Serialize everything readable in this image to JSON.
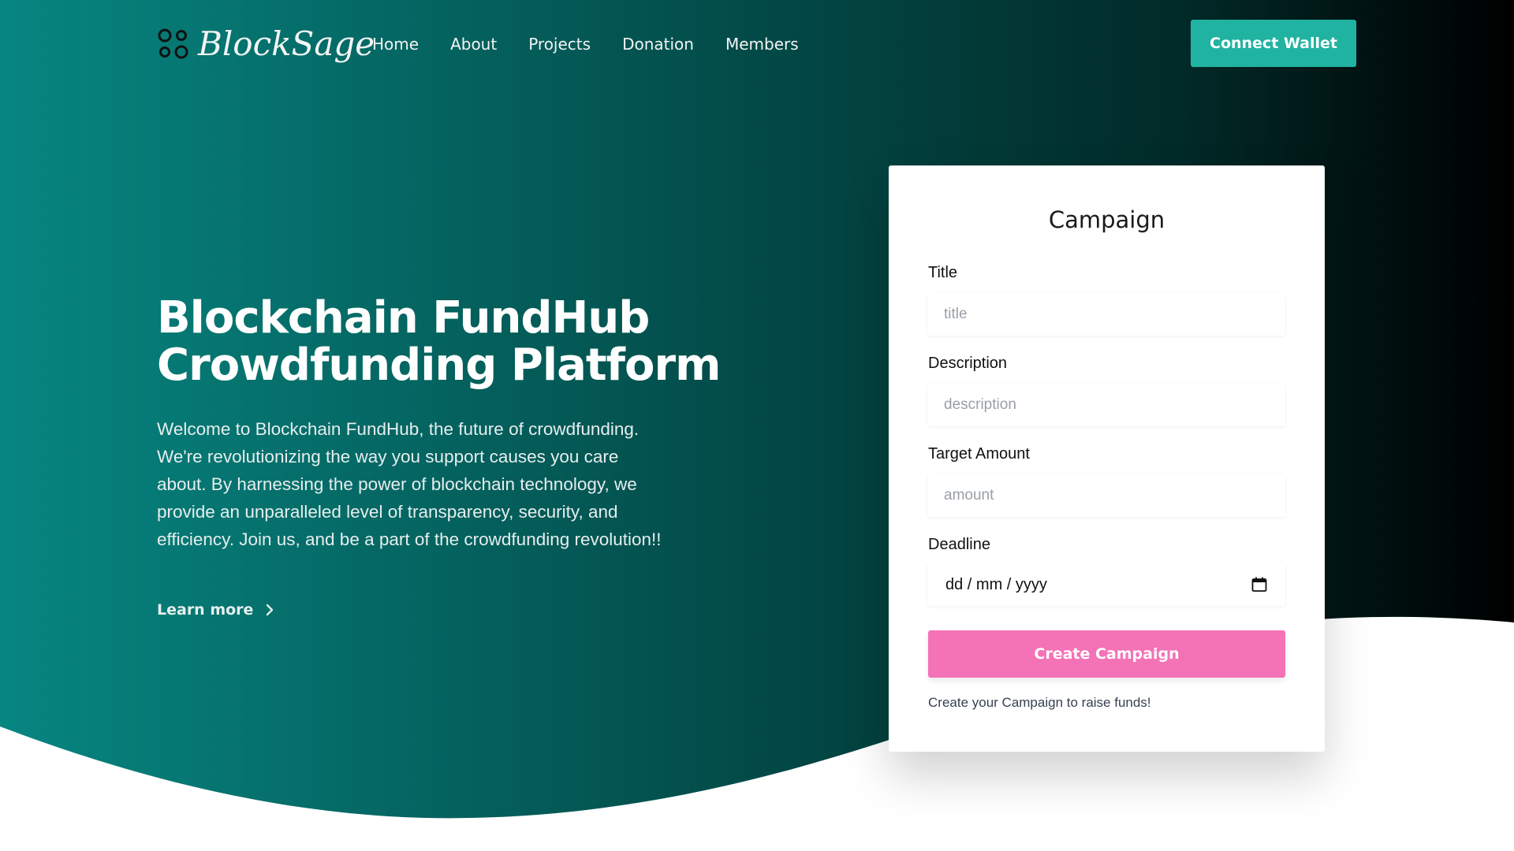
{
  "brand": {
    "name": "BlockSage",
    "logo_icon": "four-circles-logo-icon"
  },
  "nav": {
    "items": [
      {
        "label": "Home"
      },
      {
        "label": "About"
      },
      {
        "label": "Projects"
      },
      {
        "label": "Donation"
      },
      {
        "label": "Members"
      }
    ],
    "connect_label": "Connect Wallet"
  },
  "hero": {
    "title_line1": "Blockchain FundHub",
    "title_line2": "Crowdfunding Platform",
    "description": "Welcome to Blockchain FundHub, the future of crowdfunding. We're revolutionizing the way you support causes you care about. By harnessing the power of blockchain technology, we provide an unparalleled level of transparency, security, and efficiency. Join us, and be a part of the crowdfunding revolution!!",
    "learn_more": "Learn more",
    "learn_more_icon": "chevron-right-icon"
  },
  "campaign": {
    "heading": "Campaign",
    "fields": {
      "title": {
        "label": "Title",
        "placeholder": "title",
        "value": ""
      },
      "description": {
        "label": "Description",
        "placeholder": "description",
        "value": ""
      },
      "amount": {
        "label": "Target Amount",
        "placeholder": "amount",
        "value": ""
      },
      "deadline": {
        "label": "Deadline",
        "value": "dd / mm / yyyy",
        "icon": "calendar-icon"
      }
    },
    "submit_label": "Create Campaign",
    "footnote": "Create your Campaign to raise funds!"
  },
  "colors": {
    "hero_gradient_start": "#078681",
    "hero_gradient_end": "#000000",
    "accent_teal": "#21b3a1",
    "submit_pink": "#f472b6",
    "card_bg": "#ffffff"
  }
}
